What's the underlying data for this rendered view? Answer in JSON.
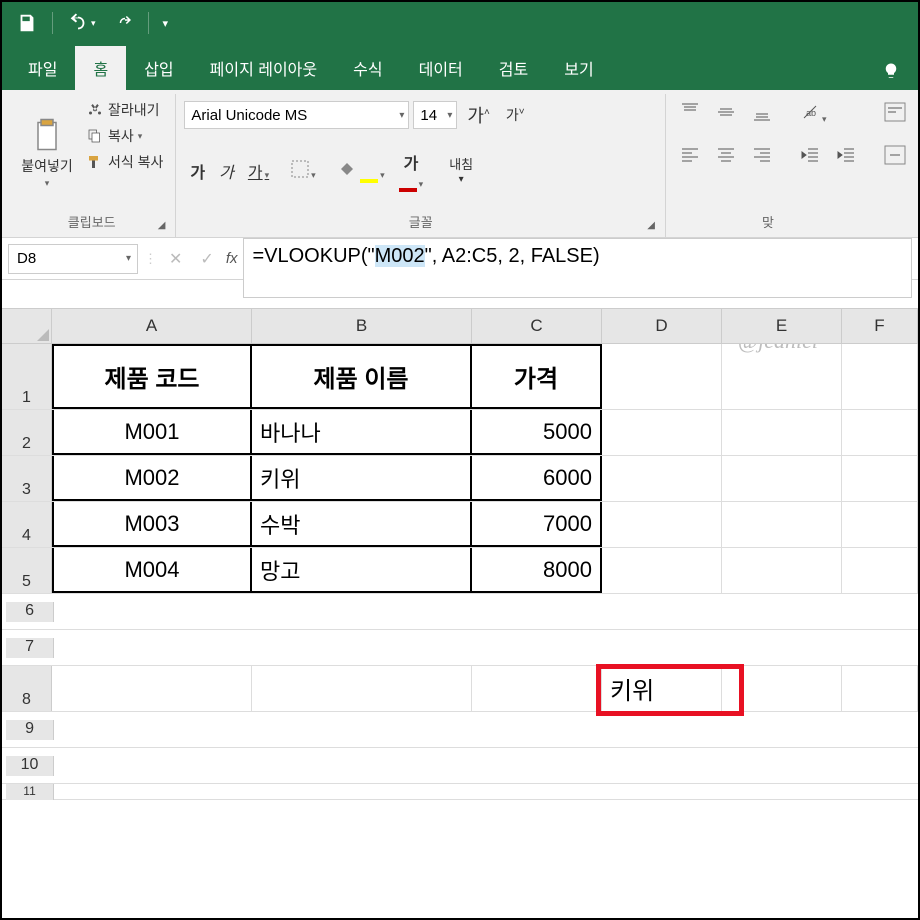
{
  "qat": {
    "save": "save-icon",
    "undo": "undo-icon",
    "redo": "redo-icon"
  },
  "tabs": {
    "file": "파일",
    "home": "홈",
    "insert": "삽입",
    "pageLayout": "페이지 레이아웃",
    "formulas": "수식",
    "data": "데이터",
    "review": "검토",
    "view": "보기"
  },
  "ribbon": {
    "clipboard": {
      "paste": "붙여넣기",
      "cut": "잘라내기",
      "copy": "복사",
      "formatPainter": "서식 복사",
      "label": "클립보드"
    },
    "font": {
      "name": "Arial Unicode MS",
      "size": "14",
      "grow": "가",
      "shrink": "가",
      "bold": "가",
      "italic": "가",
      "underline": "가",
      "label": "글꼴",
      "wrap": "내침"
    },
    "alignment": {
      "label": "맞"
    }
  },
  "nameBox": "D8",
  "formula": {
    "prefix": "=VLOOKUP(",
    "arg1q1": "\"",
    "arg1": "M002",
    "arg1q2": "\"",
    "rest": ", A2:C5, 2, FALSE)"
  },
  "watermark": "@jeaniel",
  "columns": [
    "A",
    "B",
    "C",
    "D",
    "E",
    "F"
  ],
  "headerRow": {
    "A": "제품 코드",
    "B": "제품 이름",
    "C": "가격"
  },
  "rows": [
    {
      "n": "2",
      "A": "M001",
      "B": "바나나",
      "C": "5000"
    },
    {
      "n": "3",
      "A": "M002",
      "B": "키위",
      "C": "6000"
    },
    {
      "n": "4",
      "A": "M003",
      "B": "수박",
      "C": "7000"
    },
    {
      "n": "5",
      "A": "M004",
      "B": "망고",
      "C": "8000"
    }
  ],
  "result": {
    "row": "8",
    "value": "키위"
  },
  "emptyRows": [
    "6",
    "7",
    "8",
    "9",
    "10",
    "11"
  ]
}
